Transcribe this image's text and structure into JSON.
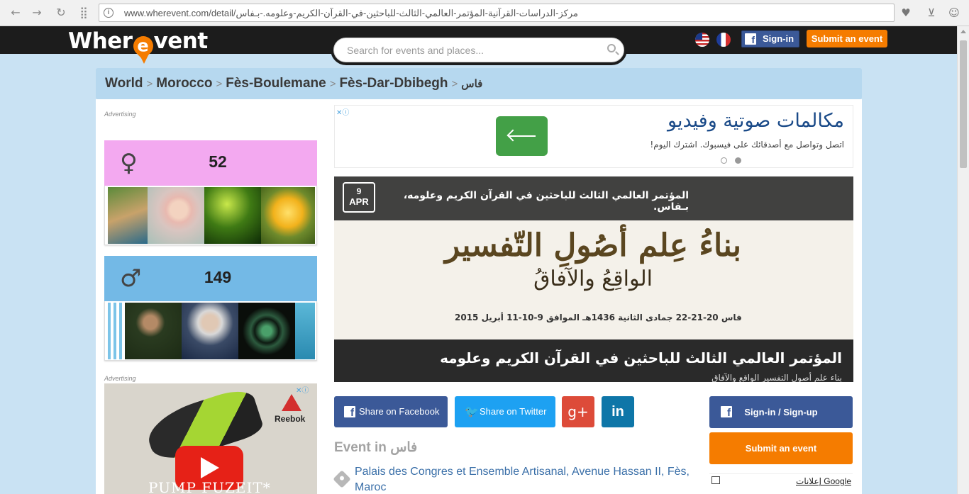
{
  "browser": {
    "url": "www.wherevent.com/detail/مركز-الدراسات-القرآنية-المؤتمر-العالمي-الثالث-للباحثين-في-القرآن-الكريم-وعلومه.-بـفاس"
  },
  "header": {
    "logo_left": "Wher",
    "logo_pin_letter": "e",
    "logo_right": "vent",
    "signin_label": "Sign-in",
    "submit_label": "Submit an event",
    "search_placeholder": "Search for events and places..."
  },
  "breadcrumb": {
    "items": [
      "World",
      "Morocco",
      "Fès-Boulemane",
      "Fès-Dar-Dbibegh",
      "فاس"
    ],
    "separator": ">"
  },
  "sidebar": {
    "advertising_label": "Advertising",
    "female": {
      "icon": "female-icon",
      "symbol": "♀",
      "count": "52",
      "color": "#f3a9f0"
    },
    "male": {
      "icon": "male-icon",
      "symbol": "♂",
      "count": "149",
      "color": "#73b9e6"
    }
  },
  "top_ad": {
    "title": "مكالمات صوتية وفيديو",
    "subtitle": "اتصل وتواصل مع أصدقائك على فيسبوك. اشترك اليوم!"
  },
  "event": {
    "day": "9",
    "month": "APR",
    "title": "المؤتمر العالمي الثالث للباحثين في القرآن الكريم وعلومه، بـفاس.",
    "art_line1": "بناءُ عِلم أصُولِ التّفسير",
    "art_line2": "الواقِعُ والآفاقُ",
    "art_date": "فاس 20-21-22 جمادى الثانية 1436هـ الموافق 9-10-11 أبريل 2015",
    "bottom_title": "المؤتمر العالمي الثالث للباحثين في القرآن الكريم وعلومه",
    "bottom_sub": "بناء علم أصول التفسير الواقع والآفاق",
    "event_in_label": "Event in",
    "event_in_city": "فاس",
    "address": "Palais des Congres et Ensemble Artisanal, Avenue Hassan II, Fès, Maroc"
  },
  "share": {
    "facebook": "Share on Facebook",
    "twitter": "Share on Twitter",
    "googleplus": "g+",
    "linkedin": "in"
  },
  "right": {
    "signin": "Sign-in / Sign-up",
    "submit": "Submit an event",
    "google_ads": "إعلانات Google"
  },
  "side_ad": {
    "brand": "Reebok",
    "text": "PUMP FUZEIT*"
  },
  "colors": {
    "accent": "#f57c00",
    "facebook": "#3b5998",
    "twitter": "#1da1f2",
    "googleplus": "#dd4b39",
    "linkedin": "#0e76a8"
  }
}
